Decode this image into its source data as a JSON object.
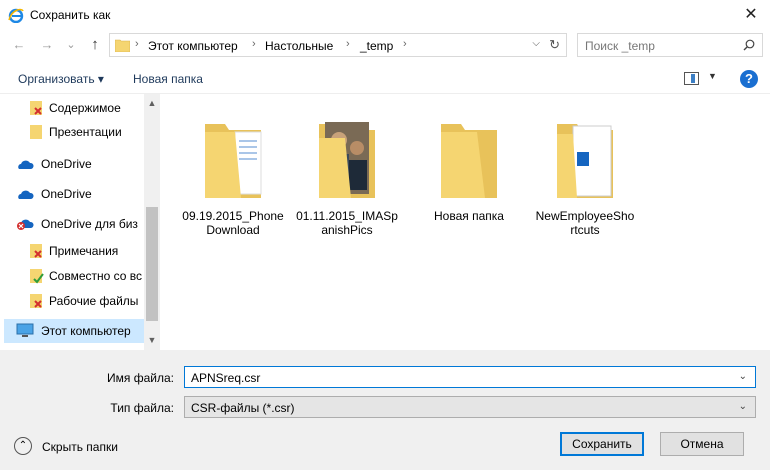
{
  "window": {
    "title": "Сохранить как",
    "close_glyph": "✕"
  },
  "nav": {
    "back": "←",
    "forward": "→",
    "recent": "⌄",
    "up": "↑",
    "breadcrumbs": [
      "Этот компьютер",
      "Настольные",
      "_temp"
    ],
    "sep": "›",
    "search_placeholder": "Поиск _temp"
  },
  "toolbar": {
    "organize": "Организовать ▾",
    "new_folder": "Новая папка",
    "help": "?"
  },
  "sidebar": {
    "items": [
      {
        "label": "Содержимое",
        "icon": "folder-error-icon"
      },
      {
        "label": "Презентации",
        "icon": "folder-icon"
      },
      {
        "label": "OneDrive",
        "icon": "onedrive-icon"
      },
      {
        "label": "OneDrive",
        "icon": "onedrive-icon"
      },
      {
        "label": "OneDrive для биз",
        "icon": "onedrive-error-icon"
      },
      {
        "label": "Примечания",
        "icon": "folder-error-icon"
      },
      {
        "label": "Совместно со вс",
        "icon": "folder-sync-icon"
      },
      {
        "label": "Рабочие файлы",
        "icon": "folder-error-icon"
      },
      {
        "label": "Этот компьютер",
        "icon": "computer-icon"
      }
    ],
    "selected": "Этот компьютер"
  },
  "files": [
    {
      "name": "09.19.2015_Phone Download",
      "type": "folder-with-documents"
    },
    {
      "name": "01.11.2015_IMASp anishPics",
      "type": "folder-with-photo"
    },
    {
      "name": "Новая папка",
      "type": "folder-empty"
    },
    {
      "name": "NewEmployeeSho rtcuts",
      "type": "folder-with-shortcut"
    }
  ],
  "form": {
    "filename_label": "Имя файла:",
    "filename_value": "APNSreq.csr",
    "filetype_label": "Тип файла:",
    "filetype_value": "CSR-файлы (*.csr)"
  },
  "footer": {
    "hide_folders": "Скрыть папки",
    "save": "Сохранить",
    "cancel": "Отмена"
  },
  "colors": {
    "folder": "#f5d571",
    "accent": "#0078d7",
    "selection": "#cce8ff"
  }
}
